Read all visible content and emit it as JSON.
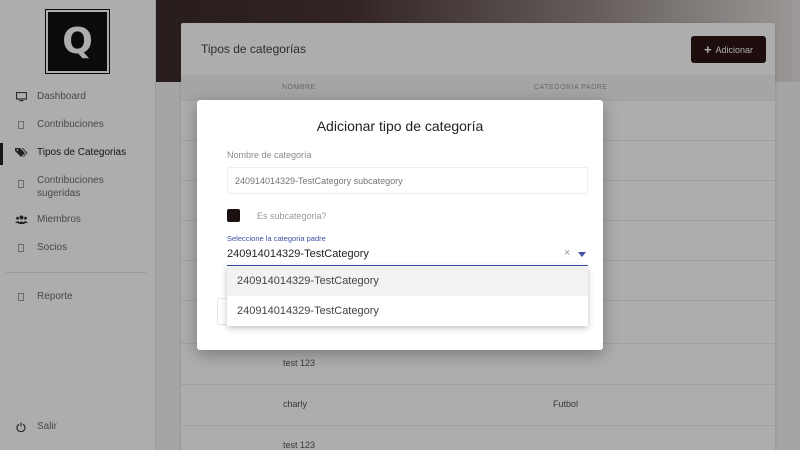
{
  "sidebar": {
    "logo_letter": "Q",
    "items": [
      {
        "label": "Dashboard",
        "icon": "monitor-icon"
      },
      {
        "label": "Contribuciones",
        "icon": "square-icon"
      },
      {
        "label": "Tipos de Categorias",
        "icon": "tags-icon"
      },
      {
        "label": "Contribuciones sugeridas",
        "icon": "square-icon"
      },
      {
        "label": "Miembros",
        "icon": "users-icon"
      },
      {
        "label": "Socios",
        "icon": "square-icon"
      },
      {
        "label": "Reporte",
        "icon": "square-icon"
      },
      {
        "label": "Salir",
        "icon": "power-icon"
      }
    ]
  },
  "main": {
    "title": "Tipos de categorías",
    "add_button": "Adicionar",
    "columns": [
      "NOMBRE",
      "CATEGORIA PADRE"
    ],
    "rows": [
      {
        "name": "test 123",
        "parent": ""
      },
      {
        "name": "charly",
        "parent": "Futbol"
      },
      {
        "name": "test 123",
        "parent": ""
      }
    ]
  },
  "modal": {
    "title": "Adicionar tipo de categoría",
    "name_label": "Nombre de categoría",
    "name_placeholder": "240914014329-TestCategory subcategory",
    "checkbox_label": "Es subcategoria?",
    "parent_label": "Seleccione la categoria padre",
    "parent_value": "240914014329-TestCategory",
    "clear_symbol": "×",
    "options": [
      "240914014329-TestCategory",
      "240914014329-TestCategory"
    ]
  },
  "colors": {
    "accent": "#2b1414",
    "select_underline": "#3c50a8"
  }
}
